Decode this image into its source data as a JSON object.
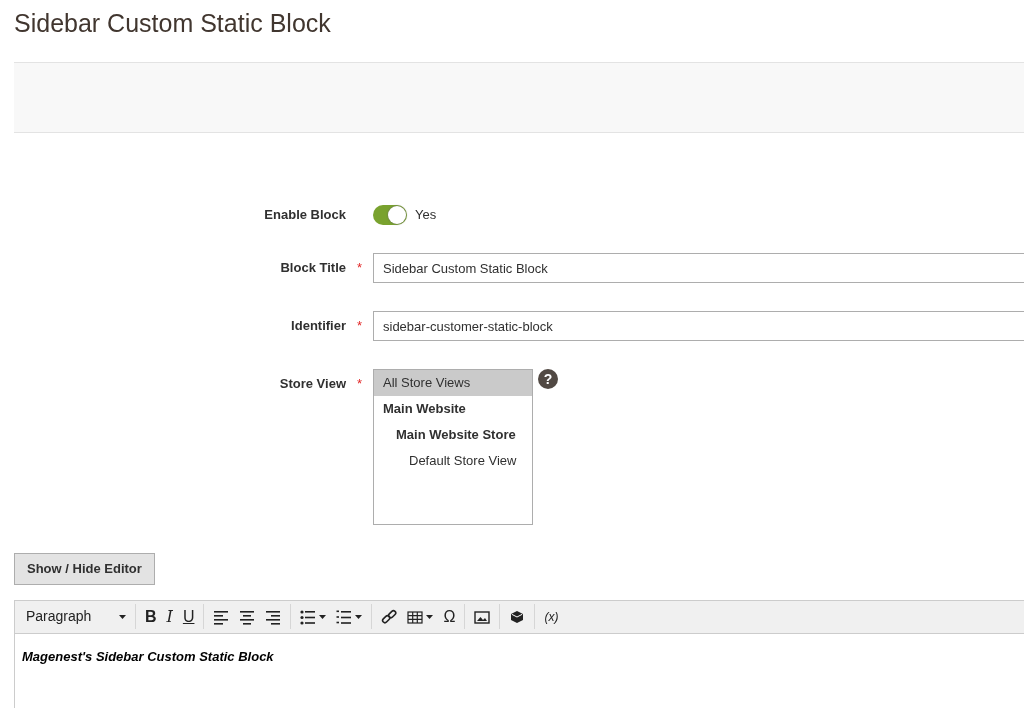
{
  "page_title": "Sidebar Custom Static Block",
  "form": {
    "enable": {
      "label": "Enable Block",
      "on": true,
      "value_text": "Yes"
    },
    "fields": [
      {
        "label": "Block Title",
        "required_mark": "*",
        "value": "Sidebar Custom Static Block"
      },
      {
        "label": "Identifier",
        "required_mark": "*",
        "value": "sidebar-customer-static-block"
      }
    ],
    "store_view": {
      "label": "Store View",
      "required_mark": "*",
      "help": "?",
      "options": [
        {
          "label": "All Store Views",
          "selected": true
        },
        {
          "label": "Main Website",
          "selected": false,
          "bold": true,
          "children": [
            {
              "label": "Main Website Store",
              "selected": false,
              "bold": true,
              "children": [
                {
                  "label": "Default Store View",
                  "selected": false
                }
              ]
            }
          ]
        }
      ]
    }
  },
  "editor_toggle": "Show / Hide Editor",
  "toolbar": [
    [
      {
        "kind": "dropdown",
        "label": "Paragraph"
      }
    ],
    [
      {
        "kind": "text",
        "label": "B"
      },
      {
        "kind": "text",
        "label": "I"
      },
      {
        "kind": "text",
        "label": "U"
      }
    ],
    [
      {
        "kind": "icon"
      },
      {
        "kind": "icon"
      },
      {
        "kind": "icon"
      }
    ],
    [
      {
        "kind": "icon",
        "menu": true
      },
      {
        "kind": "icon",
        "menu": true
      }
    ],
    [
      {
        "kind": "icon"
      },
      {
        "kind": "icon",
        "menu": true
      },
      {
        "kind": "text",
        "label": "Ω"
      }
    ],
    [
      {
        "kind": "icon"
      }
    ],
    [
      {
        "kind": "icon"
      }
    ],
    [
      {
        "kind": "text",
        "label": "(x)"
      }
    ]
  ],
  "editor_content": "Magenest's Sidebar Custom Static Block"
}
